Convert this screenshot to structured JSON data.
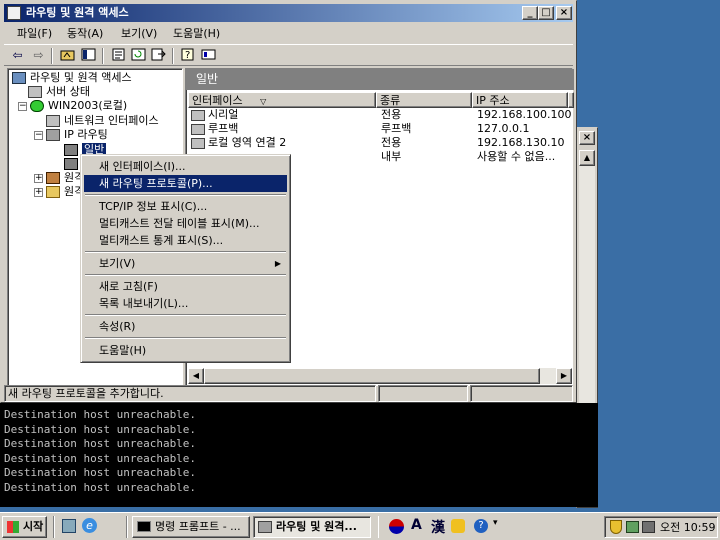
{
  "window": {
    "title": "라우팅 및 원격 액세스",
    "min_label": "_",
    "max_label": "□",
    "close_label": "×"
  },
  "menu": [
    "파일(F)",
    "동작(A)",
    "보기(V)",
    "도움말(H)"
  ],
  "tree": {
    "root": "라우팅 및 원격 액세스",
    "server_status": "서버 상태",
    "server": "WIN2003(로컬)",
    "network_interfaces": "네트워크 인터페이스",
    "ip_routing": "IP 라우팅",
    "general": "일반",
    "partial_1": "원격",
    "partial_2": "원격"
  },
  "panel": {
    "header": "일반",
    "columns": [
      "인터페이스",
      "종류",
      "IP 주소"
    ],
    "rows": [
      {
        "name": "시리얼",
        "type": "전용",
        "ip": "192.168.100.100"
      },
      {
        "name": "루프백",
        "type": "루프백",
        "ip": "127.0.0.1"
      },
      {
        "name": "로컬 영역 연결 2",
        "type": "전용",
        "ip": "192.168.130.10"
      },
      {
        "name": "",
        "type": "내부",
        "ip": "사용할 수 없음..."
      }
    ]
  },
  "status_text": "새 라우팅 프로토콜을 추가합니다.",
  "context_menu": [
    {
      "label": "새 인터페이스(I)...",
      "selected": false
    },
    {
      "label": "새 라우팅 프로토콜(P)...",
      "selected": true
    },
    {
      "label": "TCP/IP 정보 표시(C)...",
      "selected": false
    },
    {
      "label": "멀티캐스트 전달 테이블 표시(M)...",
      "selected": false
    },
    {
      "label": "멀티캐스트 통계 표시(S)...",
      "selected": false
    },
    {
      "label": "보기(V)",
      "selected": false,
      "submenu": true
    },
    {
      "label": "새로 고침(F)",
      "selected": false
    },
    {
      "label": "목록 내보내기(L)...",
      "selected": false
    },
    {
      "label": "속성(R)",
      "selected": false
    },
    {
      "label": "도움말(H)",
      "selected": false
    }
  ],
  "console_lines": [
    "Destination host unreachable.",
    "Destination host unreachable.",
    "Destination host unreachable.",
    "Destination host unreachable.",
    "Destination host unreachable.",
    "Destination host unreachable."
  ],
  "taskbar": {
    "start": "시작",
    "task1": "명령 프롬프트 - ...",
    "task2": "라우팅 및 원격...",
    "ime_a": "A",
    "ime_han": "漢",
    "clock": "오전 10:59"
  },
  "colors": {
    "desktop": "#3a6ea5",
    "titlebar": "#0a246a",
    "selection": "#0a246a"
  }
}
